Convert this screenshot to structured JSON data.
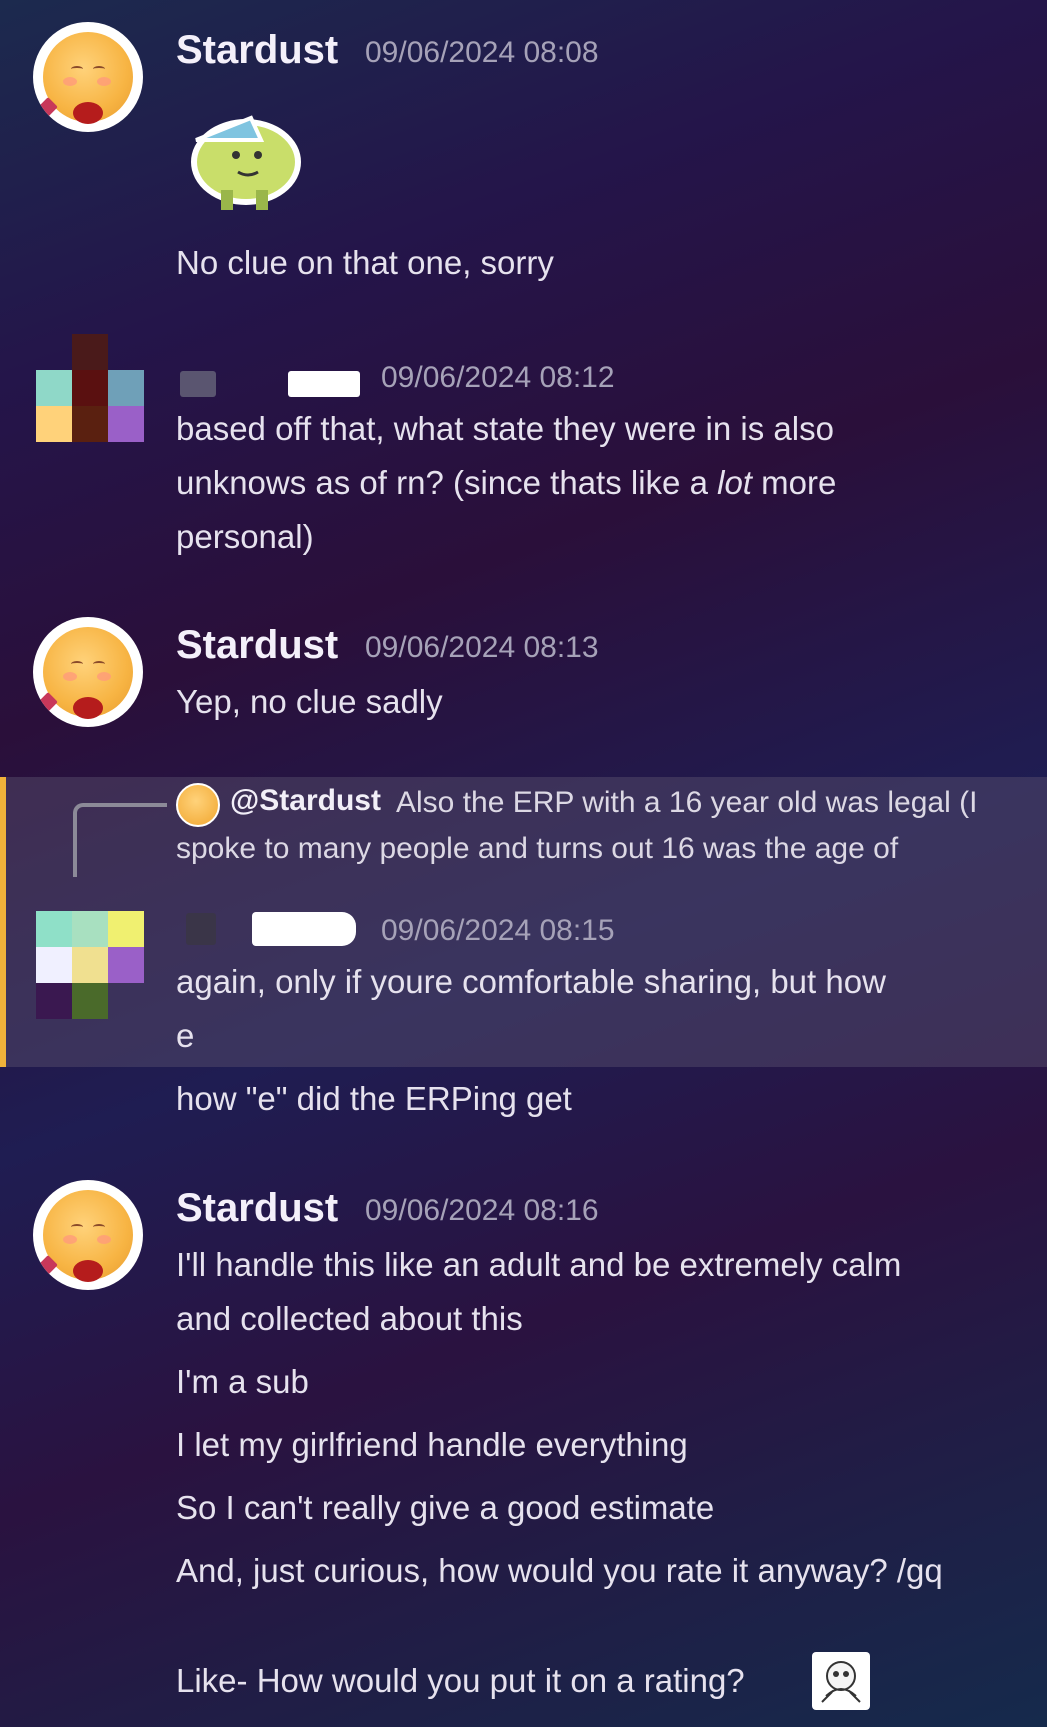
{
  "messages": [
    {
      "author": "Stardust",
      "timestamp": "09/06/2024 08:08",
      "sticker": "shrug-sticker",
      "lines": [
        "No clue on that one, sorry"
      ]
    },
    {
      "author": "",
      "timestamp": "09/06/2024 08:12",
      "lines": [
        "based off that, what state they were in is also",
        "unknows as of rn? (since thats like a ",
        "lot",
        " more",
        "personal)"
      ]
    },
    {
      "author": "Stardust",
      "timestamp": "09/06/2024 08:13",
      "lines": [
        "Yep, no clue sadly"
      ]
    },
    {
      "author": "",
      "timestamp": "09/06/2024 08:15",
      "reply": {
        "name": "@Stardust",
        "text1": "Also the ERP with a 16 year old was legal (I",
        "text2": "spoke to many people and turns out 16 was the age of"
      },
      "lines": [
        "again, only if youre comfortable sharing, but how",
        "e",
        "how \"e\" did the ERPing get"
      ]
    },
    {
      "author": "Stardust",
      "timestamp": "09/06/2024 08:16",
      "lines": [
        "I'll handle this like an adult and be extremely calm",
        "and collected about this",
        "I'm a sub",
        "I let my girlfriend handle everything",
        "So I can't really give a good estimate",
        "And, just curious, how would you rate it anyway? /gq",
        "Like- How would you put it on a rating?"
      ]
    }
  ],
  "colors": {
    "accent_bar": "#f0b23a",
    "timestamp": "#a6a2b8"
  }
}
